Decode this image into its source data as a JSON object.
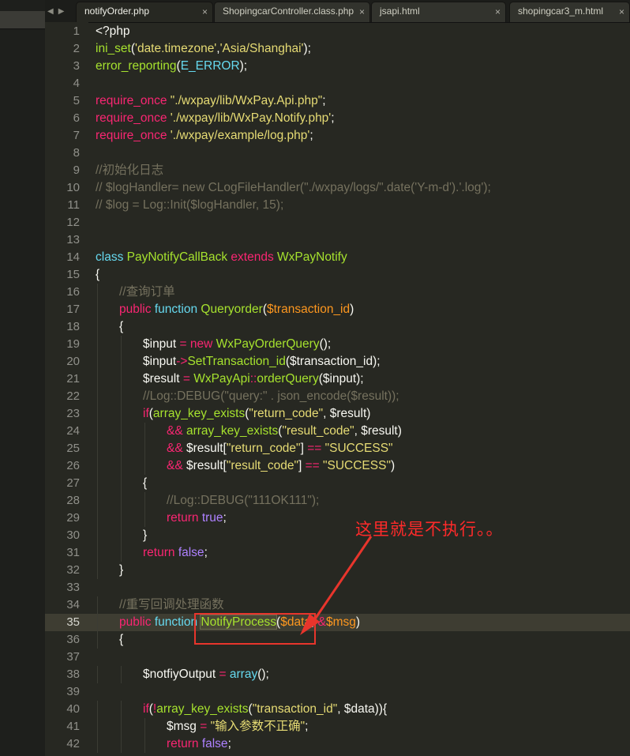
{
  "tabs": [
    {
      "label": "notifyOrder.php",
      "active": true
    },
    {
      "label": "ShopingcarController.class.php",
      "active": false
    },
    {
      "label": "jsapi.html",
      "active": false
    },
    {
      "label": "shopingcar3_m.html",
      "active": false
    }
  ],
  "tab_close_glyph": "×",
  "nav": {
    "prev": "◀",
    "next": "▶"
  },
  "highlighted_line": 35,
  "lines": [
    [
      [
        "",
        "<?php"
      ]
    ],
    [
      [
        "fn",
        "ini_set"
      ],
      [
        "",
        "("
      ],
      [
        "st",
        "'date.timezone'"
      ],
      [
        "",
        ","
      ],
      [
        "st",
        "'Asia/Shanghai'"
      ],
      [
        "",
        ");"
      ]
    ],
    [
      [
        "fn",
        "error_reporting"
      ],
      [
        "",
        "("
      ],
      [
        "bi",
        "E_ERROR"
      ],
      [
        "",
        ");"
      ]
    ],
    [],
    [
      [
        "kw",
        "require_once "
      ],
      [
        "st",
        "\"./wxpay/lib/WxPay.Api.php\""
      ],
      [
        "",
        ";"
      ]
    ],
    [
      [
        "kw",
        "require_once "
      ],
      [
        "st",
        "'./wxpay/lib/WxPay.Notify.php'"
      ],
      [
        "",
        ";"
      ]
    ],
    [
      [
        "kw",
        "require_once "
      ],
      [
        "st",
        "'./wxpay/example/log.php'"
      ],
      [
        "",
        ";"
      ]
    ],
    [],
    [
      [
        "cm",
        "//初始化日志"
      ]
    ],
    [
      [
        "cm",
        "// $logHandler= new CLogFileHandler(\"./wxpay/logs/\".date('Y-m-d').'.log');"
      ]
    ],
    [
      [
        "cm",
        "// $log = Log::Init($logHandler, 15);"
      ]
    ],
    [],
    [],
    [
      [
        "bi",
        "class "
      ],
      [
        "fn",
        "PayNotifyCallBack "
      ],
      [
        "kw",
        "extends "
      ],
      [
        "fn",
        "WxPayNotify"
      ]
    ],
    [
      [
        "",
        "{"
      ]
    ],
    [
      [
        "cm",
        "//查询订单"
      ]
    ],
    [
      [
        "kw",
        "public "
      ],
      [
        "bi",
        "function "
      ],
      [
        "fn",
        "Queryorder"
      ],
      [
        "",
        "("
      ],
      [
        "pm",
        "$transaction_id"
      ],
      [
        "",
        ")"
      ]
    ],
    [
      [
        "",
        "{"
      ]
    ],
    [
      [
        "",
        "$input "
      ],
      [
        "kw",
        "= new "
      ],
      [
        "fn",
        "WxPayOrderQuery"
      ],
      [
        "",
        "();"
      ]
    ],
    [
      [
        "",
        "$input"
      ],
      [
        "kw",
        "->"
      ],
      [
        "fn",
        "SetTransaction_id"
      ],
      [
        "",
        "($transaction_id);"
      ]
    ],
    [
      [
        "",
        "$result "
      ],
      [
        "kw",
        "= "
      ],
      [
        "fn",
        "WxPayApi"
      ],
      [
        "kw",
        "::"
      ],
      [
        "fn",
        "orderQuery"
      ],
      [
        "",
        "($input);"
      ]
    ],
    [
      [
        "cm",
        "//Log::DEBUG(\"query:\" . json_encode($result));"
      ]
    ],
    [
      [
        "kw",
        "if"
      ],
      [
        "",
        "("
      ],
      [
        "fn",
        "array_key_exists"
      ],
      [
        "",
        "("
      ],
      [
        "st",
        "\"return_code\""
      ],
      [
        "",
        ", $result)"
      ]
    ],
    [
      [
        "kw",
        "&& "
      ],
      [
        "fn",
        "array_key_exists"
      ],
      [
        "",
        "("
      ],
      [
        "st",
        "\"result_code\""
      ],
      [
        "",
        ", $result)"
      ]
    ],
    [
      [
        "kw",
        "&& "
      ],
      [
        "",
        "$result["
      ],
      [
        "st",
        "\"return_code\""
      ],
      [
        "",
        "] "
      ],
      [
        "kw",
        "== "
      ],
      [
        "st",
        "\"SUCCESS\""
      ]
    ],
    [
      [
        "kw",
        "&& "
      ],
      [
        "",
        "$result["
      ],
      [
        "st",
        "\"result_code\""
      ],
      [
        "",
        "] "
      ],
      [
        "kw",
        "== "
      ],
      [
        "st",
        "\"SUCCESS\""
      ],
      [
        "",
        ")"
      ]
    ],
    [
      [
        "",
        "{"
      ]
    ],
    [
      [
        "cm",
        "//Log::DEBUG(\"111OK111\");"
      ]
    ],
    [
      [
        "kw",
        "return "
      ],
      [
        "cn",
        "true"
      ],
      [
        "",
        ";"
      ]
    ],
    [
      [
        "",
        "}"
      ]
    ],
    [
      [
        "kw",
        "return "
      ],
      [
        "cn",
        "false"
      ],
      [
        "",
        ";"
      ]
    ],
    [
      [
        "",
        "}"
      ]
    ],
    [],
    [
      [
        "cm",
        "//重写回调处理函数"
      ]
    ],
    [
      [
        "kw",
        "public "
      ],
      [
        "bi",
        "function "
      ],
      [
        "sel",
        "NotifyProcess"
      ],
      [
        "",
        "("
      ],
      [
        "pm",
        "$data"
      ],
      [
        "",
        ", "
      ],
      [
        "kw",
        "&"
      ],
      [
        "pm",
        "$msg"
      ],
      [
        "",
        ")"
      ]
    ],
    [
      [
        "",
        "{"
      ]
    ],
    [],
    [
      [
        "",
        "$notfiyOutput "
      ],
      [
        "kw",
        "= "
      ],
      [
        "bi",
        "array"
      ],
      [
        "",
        "();"
      ]
    ],
    [],
    [
      [
        "kw",
        "if"
      ],
      [
        "",
        "("
      ],
      [
        "kw",
        "!"
      ],
      [
        "fn",
        "array_key_exists"
      ],
      [
        "",
        "("
      ],
      [
        "st",
        "\"transaction_id\""
      ],
      [
        "",
        ", $data)){"
      ]
    ],
    [
      [
        "",
        "$msg "
      ],
      [
        "kw",
        "= "
      ],
      [
        "st",
        "\"输入参数不正确\""
      ],
      [
        "",
        ";"
      ]
    ],
    [
      [
        "kw",
        "return "
      ],
      [
        "cn",
        "false"
      ],
      [
        "",
        ";"
      ]
    ]
  ],
  "indent": [
    0,
    0,
    0,
    0,
    0,
    0,
    0,
    0,
    0,
    0,
    0,
    0,
    0,
    0,
    0,
    1,
    1,
    1,
    2,
    2,
    2,
    2,
    2,
    3,
    3,
    3,
    2,
    3,
    3,
    2,
    2,
    1,
    0,
    1,
    1,
    1,
    0,
    2,
    0,
    2,
    3,
    3
  ],
  "annotation": {
    "text": "这里就是不执行。。",
    "color": "#ff2a2a"
  }
}
